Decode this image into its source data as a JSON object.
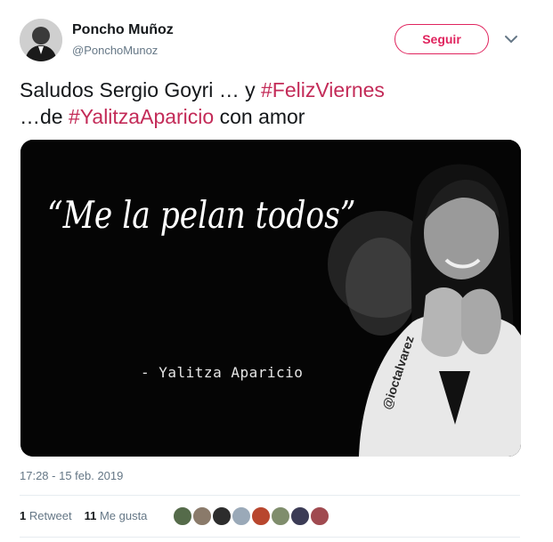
{
  "author": {
    "name": "Poncho Muñoz",
    "handle": "@PonchoMunoz"
  },
  "follow_label": "Seguir",
  "tweet": {
    "part1": "Saludos Sergio Goyri … y ",
    "hashtag1": "#FelizViernes",
    "part2": "…de ",
    "hashtag2": "#YalitzaAparicio",
    "part3": " con amor"
  },
  "media": {
    "quote": "“Me la pelan todos”",
    "attribution": "- Yalitza Aparicio",
    "watermark": "@ioctalvarez"
  },
  "timestamp": "17:28 - 15 feb. 2019",
  "stats": {
    "retweets_count": "1",
    "retweets_label": "Retweet",
    "likes_count": "11",
    "likes_label": "Me gusta"
  },
  "likers": [
    {
      "color": "#556b4a"
    },
    {
      "color": "#8a7a6a"
    },
    {
      "color": "#2d2d2d"
    },
    {
      "color": "#9aa9b8"
    },
    {
      "color": "#b8462e"
    },
    {
      "color": "#7f8d6c"
    },
    {
      "color": "#3b3b55"
    },
    {
      "color": "#a04a50"
    }
  ],
  "colors": {
    "hashtag": "#c32b58",
    "follow_border": "#e0245e",
    "secondary_text": "#657786"
  }
}
